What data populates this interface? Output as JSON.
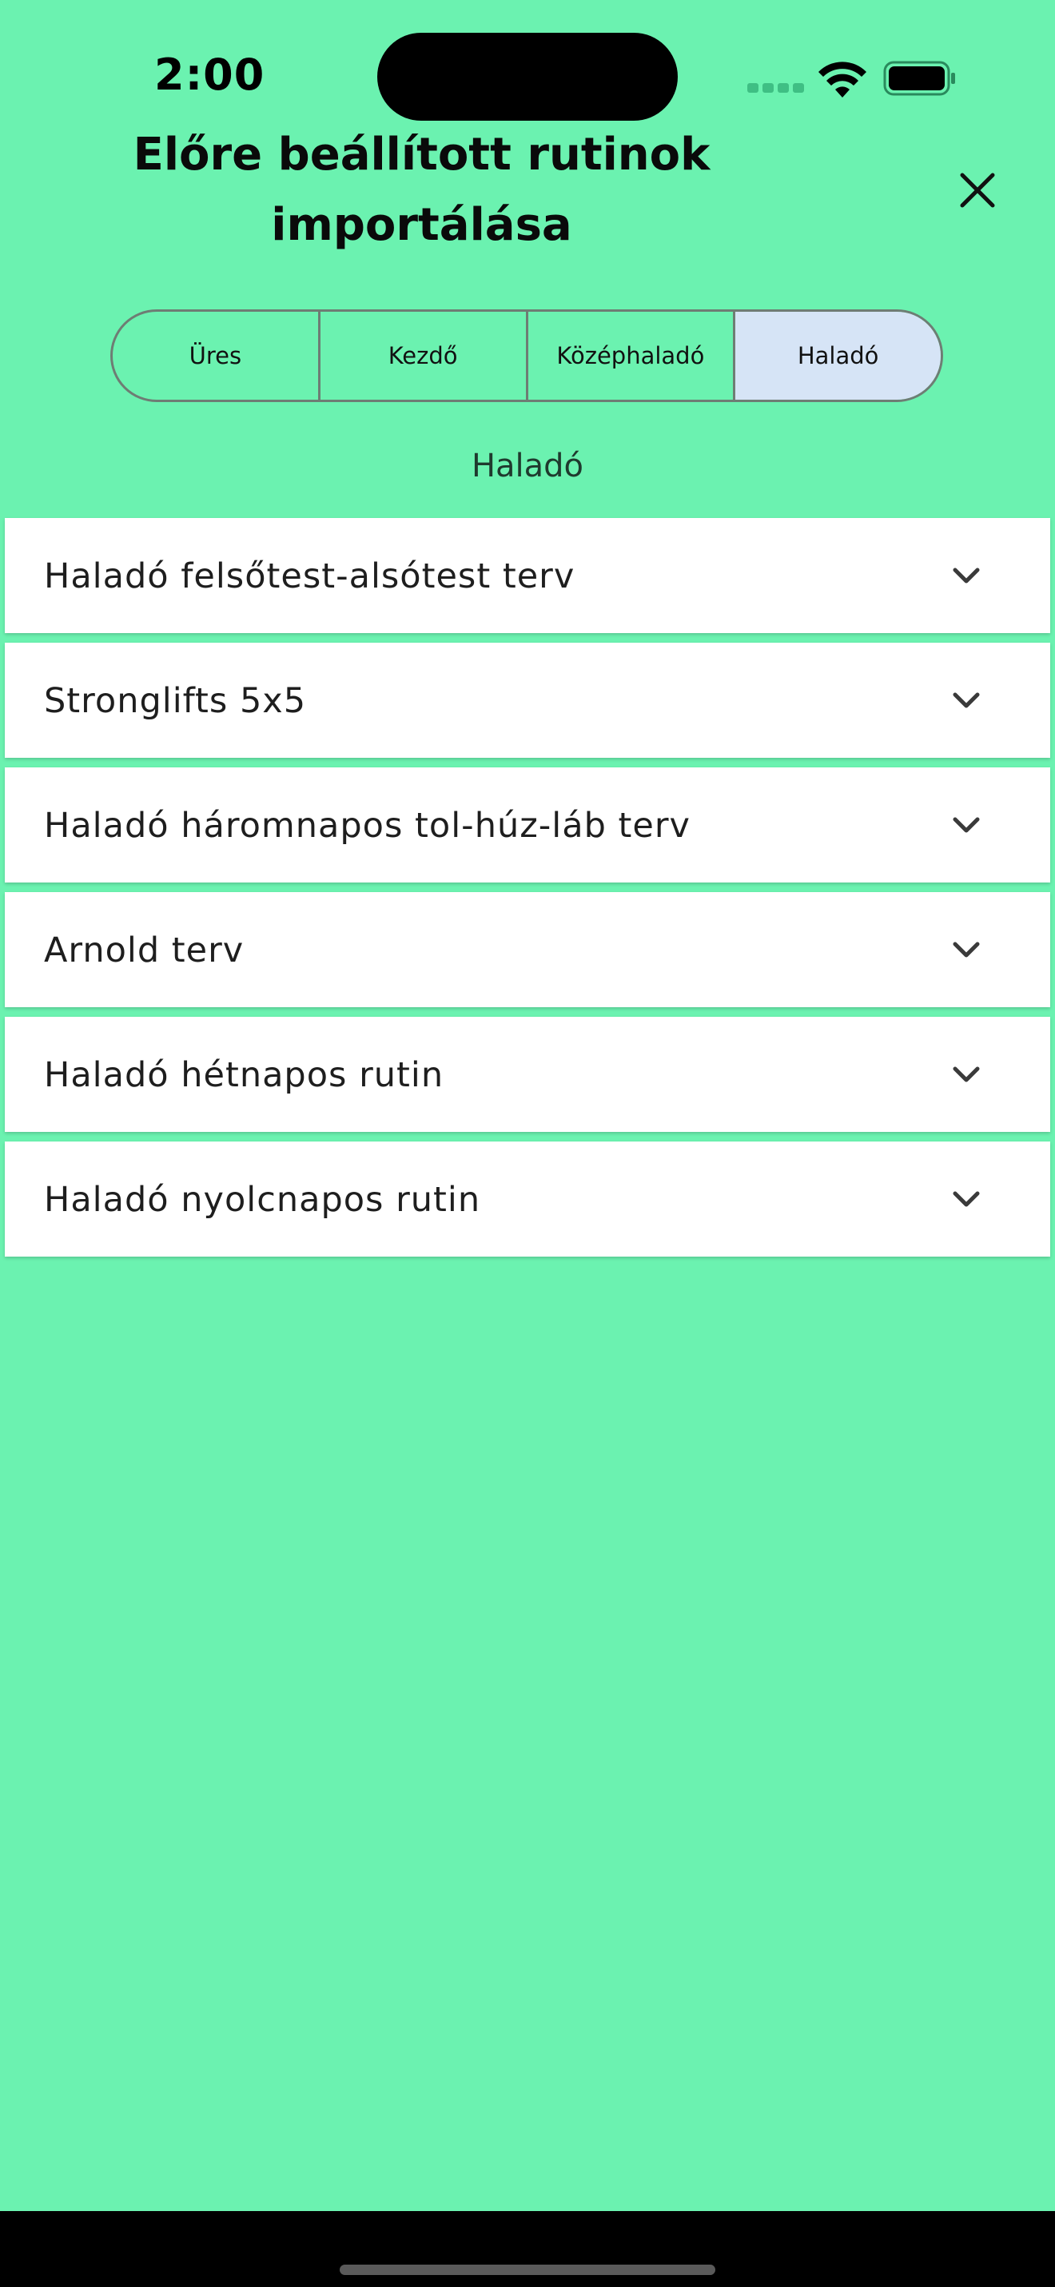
{
  "status_bar": {
    "time": "2:00"
  },
  "header": {
    "title": "Előre beállított rutinok importálása",
    "close_icon": "close-icon"
  },
  "segments": [
    {
      "label": "Üres",
      "selected": false
    },
    {
      "label": "Kezdő",
      "selected": false
    },
    {
      "label": "Középhaladó",
      "selected": false
    },
    {
      "label": "Haladó",
      "selected": true
    }
  ],
  "section_label": "Haladó",
  "routines": [
    {
      "label": "Haladó felsőtest-alsótest terv",
      "icon": "chevron-down-icon"
    },
    {
      "label": "Stronglifts 5x5",
      "icon": "chevron-down-icon"
    },
    {
      "label": "Haladó háromnapos tol-húz-láb terv",
      "icon": "chevron-down-icon"
    },
    {
      "label": "Arnold terv",
      "icon": "chevron-down-icon"
    },
    {
      "label": "Haladó hétnapos rutin",
      "icon": "chevron-down-icon"
    },
    {
      "label": "Haladó nyolcnapos rutin",
      "icon": "chevron-down-icon"
    }
  ],
  "colors": {
    "background": "#6bf2b0",
    "selected_segment": "#d6e4f6",
    "card": "#ffffff"
  }
}
